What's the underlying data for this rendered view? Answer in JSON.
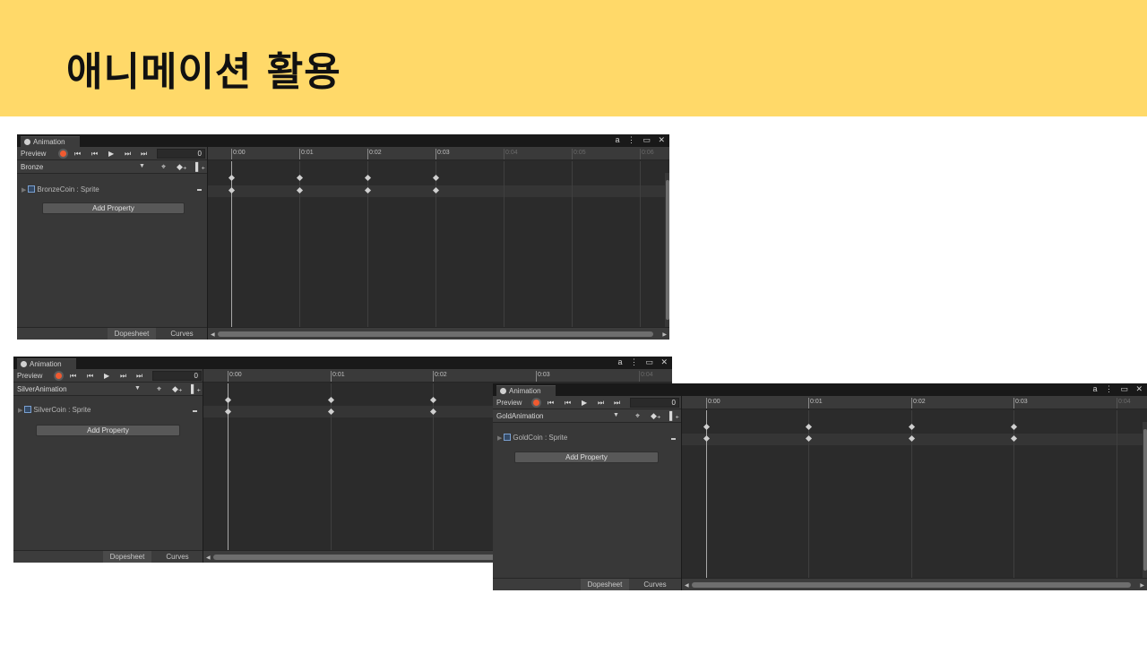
{
  "slide": {
    "title": "애니메이션 활용"
  },
  "common": {
    "tab_label": "Animation",
    "preview_label": "Preview",
    "frame_value": "0",
    "add_property_label": "Add Property",
    "dopesheet_label": "Dopesheet",
    "curves_label": "Curves",
    "window_controls": "a ⋮ ▭ ✕"
  },
  "windows": [
    {
      "id": "bronze",
      "clip_name": "Bronze",
      "property_label": "BronzeCoin : Sprite",
      "ruler": [
        "0:00",
        "0:01",
        "0:02",
        "0:03",
        "0:04",
        "0:05",
        "0:06"
      ],
      "keyframe_count": 4
    },
    {
      "id": "silver",
      "clip_name": "SilverAnimation",
      "property_label": "SilverCoin : Sprite",
      "ruler": [
        "0:00",
        "0:01",
        "0:02",
        "0:03",
        "0:04"
      ],
      "keyframe_count": 3
    },
    {
      "id": "gold",
      "clip_name": "GoldAnimation",
      "property_label": "GoldCoin : Sprite",
      "ruler": [
        "0:00",
        "0:01",
        "0:02",
        "0:03",
        "0:04"
      ],
      "keyframe_count": 4
    }
  ],
  "icons": {
    "first_key": "⏮",
    "prev_key": "⏮",
    "play": "▶",
    "next_key": "⏭",
    "last_key": "⏭",
    "filter": "⌖",
    "add_keyframe": "◆₊",
    "add_event": "▌₊"
  }
}
